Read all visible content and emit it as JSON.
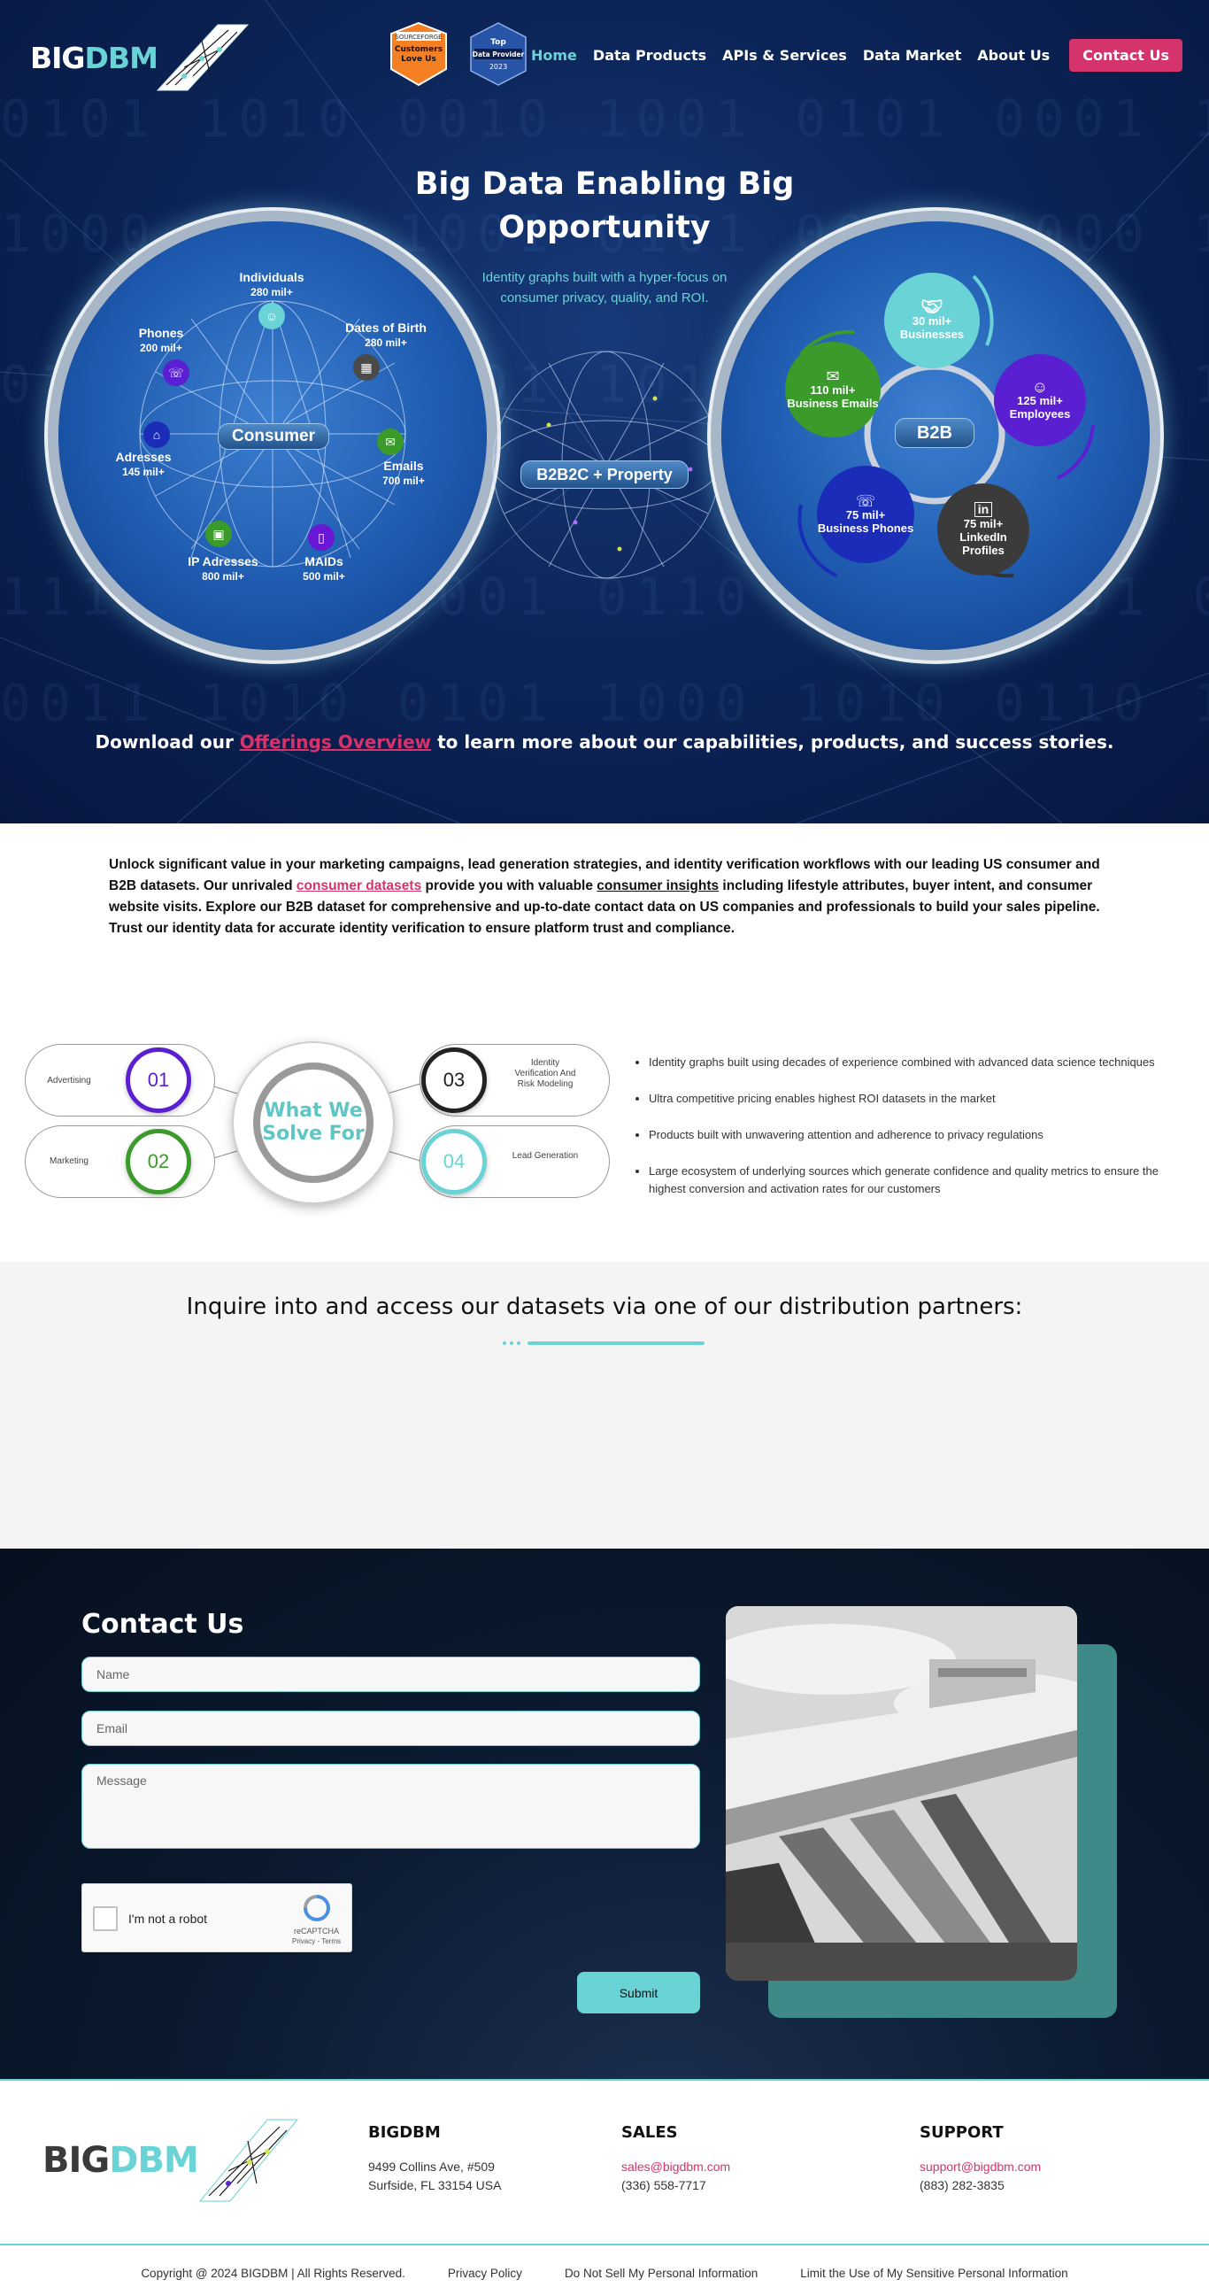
{
  "brand": {
    "logo_big": "BIG",
    "logo_dbm": "DBM"
  },
  "badges": {
    "g2_top": "SOURCEFORGE",
    "g2_line1": "Customers",
    "g2_line2": "Love Us",
    "top_line1": "Top",
    "top_line2": "Data Provider",
    "top_year": "2023"
  },
  "nav": {
    "items": [
      {
        "label": "Home",
        "active": true
      },
      {
        "label": "Data Products"
      },
      {
        "label": "APIs & Services"
      },
      {
        "label": "Data Market"
      },
      {
        "label": "About Us"
      }
    ],
    "cta": "Contact Us"
  },
  "hero": {
    "title": "Big Data Enabling Big Opportunity",
    "subtitle": "Identity graphs built with a hyper-focus on consumer privacy, quality, and ROI.",
    "center_pill": "B2B2C + Property",
    "consumer": {
      "pill": "Consumer",
      "nodes": [
        {
          "name": "Individuals",
          "value": "280 mil+"
        },
        {
          "name": "Dates of Birth",
          "value": "280 mil+"
        },
        {
          "name": "Phones",
          "value": "200 mil+"
        },
        {
          "name": "Emails",
          "value": "700 mil+"
        },
        {
          "name": "Adresses",
          "value": "145 mil+"
        },
        {
          "name": "IP Adresses",
          "value": "800 mil+"
        },
        {
          "name": "MAIDs",
          "value": "500 mil+"
        }
      ]
    },
    "b2b": {
      "pill": "B2B",
      "nodes": [
        {
          "value": "30 mil+",
          "name": "Businesses"
        },
        {
          "value": "125 mil+",
          "name": "Employees"
        },
        {
          "value": "75 mil+",
          "name": "LinkedIn Profiles"
        },
        {
          "value": "75 mil+",
          "name": "Business Phones"
        },
        {
          "value": "110 mil+",
          "name": "Business Emails"
        }
      ]
    },
    "download_prefix": "Download our",
    "download_link": "Offerings Overview",
    "download_suffix": "to learn more about our capabilities, products, and success stories."
  },
  "intro": {
    "part1": "Unlock significant value in your marketing campaigns, lead generation strategies, and identity verification workflows with our leading US consumer and B2B datasets. Our unrivaled",
    "link1": "consumer datasets",
    "part2": "provide you with valuable",
    "link2": "consumer insights",
    "part3": "including lifestyle attributes, buyer intent, and consumer website visits. Explore our B2B dataset for comprehensive and up-to-date contact data on US companies and professionals to build your sales pipeline. Trust our identity data for accurate identity verification to ensure platform trust and compliance."
  },
  "solve": {
    "center_line1": "What We",
    "center_line2": "Solve For",
    "items": [
      {
        "num": "01",
        "label": "Advertising",
        "color": "#5a1fd1"
      },
      {
        "num": "02",
        "label": "Marketing",
        "color": "#3a9a2a"
      },
      {
        "num": "03",
        "label": "Identity Verification And Risk Modeling",
        "color": "#222222"
      },
      {
        "num": "04",
        "label": "Lead Generation",
        "color": "#6ad3d6"
      }
    ],
    "bullets": [
      "Identity graphs built using decades of experience combined with advanced data science techniques",
      "Ultra competitive pricing enables highest ROI datasets in the market",
      "Products built with unwavering attention and adherence to privacy regulations",
      "Large ecosystem of underlying sources which generate confidence and quality metrics to ensure the highest conversion and activation rates for our customers"
    ]
  },
  "partners": {
    "title": "Inquire into and access our datasets via one of our distribution partners:"
  },
  "contact": {
    "title": "Contact Us",
    "name_placeholder": "Name",
    "email_placeholder": "Email",
    "message_placeholder": "Message",
    "captcha_label": "I'm not a robot",
    "captcha_brand": "reCAPTCHA",
    "captcha_links": "Privacy - Terms",
    "submit": "Submit"
  },
  "footer": {
    "col1_title": "BIGDBM",
    "col1_line1": "9499 Collins Ave, #509",
    "col1_line2": "Surfside, FL 33154 USA",
    "col2_title": "SALES",
    "col2_email": "sales@bigdbm.com",
    "col2_phone": "(336) 558-7717",
    "col3_title": "SUPPORT",
    "col3_email": "support@bigdbm.com",
    "col3_phone": "(883) 282-3835",
    "links": [
      "Copyright @ 2024 BIGDBM | All Rights Reserved.",
      "Privacy Policy",
      "Do Not Sell My Personal Information",
      "Limit the Use of My Sensitive Personal Information"
    ]
  },
  "colors": {
    "teal": "#6ad3d6",
    "pink": "#d5336b",
    "navy": "#0c2558"
  }
}
